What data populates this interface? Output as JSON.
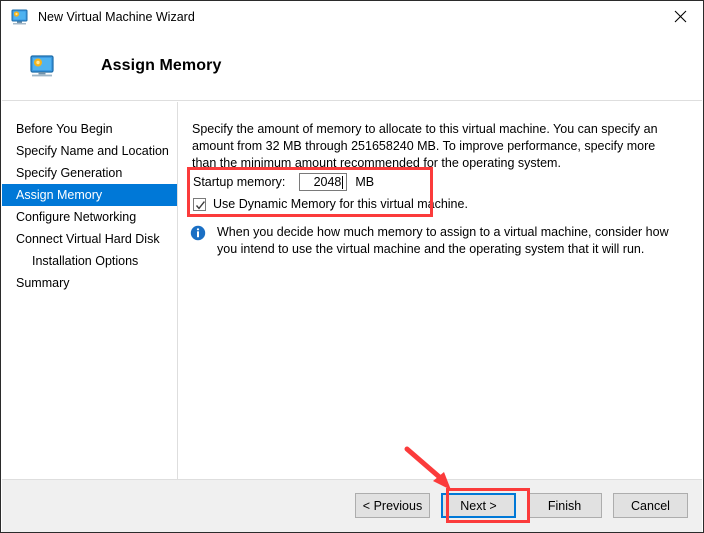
{
  "window": {
    "title": "New Virtual Machine Wizard",
    "icon": "virtual-machine-icon",
    "close_label": "✕"
  },
  "header": {
    "title": "Assign Memory",
    "icon": "virtual-machine-icon"
  },
  "sidebar": {
    "items": [
      {
        "label": "Before You Begin",
        "selected": false,
        "indent": false
      },
      {
        "label": "Specify Name and Location",
        "selected": false,
        "indent": false
      },
      {
        "label": "Specify Generation",
        "selected": false,
        "indent": false
      },
      {
        "label": "Assign Memory",
        "selected": true,
        "indent": false
      },
      {
        "label": "Configure Networking",
        "selected": false,
        "indent": false
      },
      {
        "label": "Connect Virtual Hard Disk",
        "selected": false,
        "indent": false
      },
      {
        "label": "Installation Options",
        "selected": false,
        "indent": true
      },
      {
        "label": "Summary",
        "selected": false,
        "indent": false
      }
    ]
  },
  "main": {
    "intro_text": "Specify the amount of memory to allocate to this virtual machine. You can specify an amount from 32 MB through 251658240 MB. To improve performance, specify more than the minimum amount recommended for the operating system.",
    "memory": {
      "label": "Startup memory:",
      "value": "2048",
      "unit": "MB",
      "dynamic_label": "Use Dynamic Memory for this virtual machine.",
      "dynamic_checked": true
    },
    "note": {
      "icon": "info-icon",
      "text": "When you decide how much memory to assign to a virtual machine, consider how you intend to use the virtual machine and the operating system that it will run."
    }
  },
  "footer": {
    "buttons": [
      {
        "label": "< Previous",
        "focused": false
      },
      {
        "label": "Next >",
        "focused": true
      },
      {
        "label": "Finish",
        "focused": false
      },
      {
        "label": "Cancel",
        "focused": false
      }
    ]
  },
  "annotations": {
    "color": "#fb3b3b",
    "memory_box": "highlight-startup-memory",
    "next_box": "highlight-next-button",
    "arrow": "pointer-arrow-to-next-button"
  }
}
